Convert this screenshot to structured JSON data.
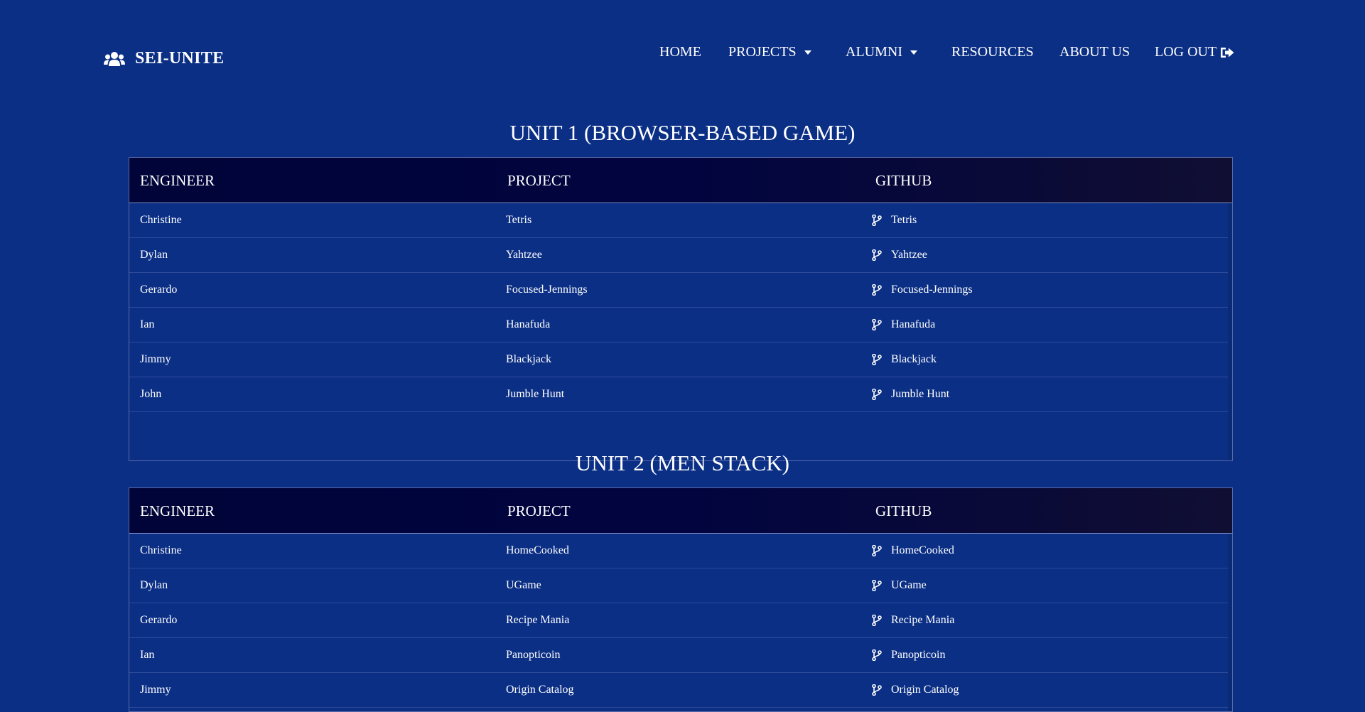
{
  "brand": {
    "name": "SEI-UNITE",
    "icon": "users-icon"
  },
  "nav": {
    "home": "HOME",
    "projects": "PROJECTS",
    "alumni": "ALUMNI",
    "resources": "RESOURCES",
    "about": "ABOUT US",
    "logout": "LOG OUT"
  },
  "colors": {
    "background": "#0b2f85",
    "table_header": "#000438",
    "text": "#ffffff"
  },
  "units": [
    {
      "title": "UNIT 1 (BROWSER-BASED GAME)",
      "headers": {
        "engineer": "ENGINEER",
        "project": "PROJECT",
        "github": "GITHUB"
      },
      "rows": [
        {
          "engineer": "Christine",
          "project": "Tetris",
          "github": "Tetris"
        },
        {
          "engineer": "Dylan",
          "project": "Yahtzee",
          "github": "Yahtzee"
        },
        {
          "engineer": "Gerardo",
          "project": "Focused-Jennings",
          "github": "Focused-Jennings"
        },
        {
          "engineer": "Ian",
          "project": "Hanafuda",
          "github": "Hanafuda"
        },
        {
          "engineer": "Jimmy",
          "project": "Blackjack",
          "github": "Blackjack"
        },
        {
          "engineer": "John",
          "project": "Jumble Hunt",
          "github": "Jumble Hunt"
        }
      ]
    },
    {
      "title": "UNIT 2 (MEN STACK)",
      "headers": {
        "engineer": "ENGINEER",
        "project": "PROJECT",
        "github": "GITHUB"
      },
      "rows": [
        {
          "engineer": "Christine",
          "project": "HomeCooked",
          "github": "HomeCooked"
        },
        {
          "engineer": "Dylan",
          "project": "UGame",
          "github": "UGame"
        },
        {
          "engineer": "Gerardo",
          "project": "Recipe Mania",
          "github": "Recipe Mania"
        },
        {
          "engineer": "Ian",
          "project": "Panopticoin",
          "github": "Panopticoin"
        },
        {
          "engineer": "Jimmy",
          "project": "Origin Catalog",
          "github": "Origin Catalog"
        }
      ]
    }
  ]
}
